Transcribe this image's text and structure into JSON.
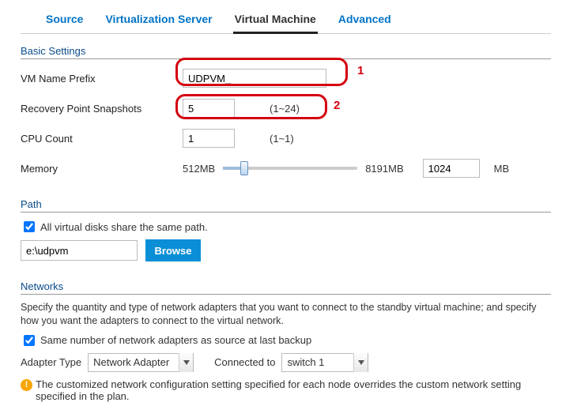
{
  "tabs": {
    "source": "Source",
    "virtualization_server": "Virtualization Server",
    "virtual_machine": "Virtual Machine",
    "advanced": "Advanced"
  },
  "basic": {
    "title": "Basic Settings",
    "vm_name_prefix_label": "VM Name Prefix",
    "vm_name_prefix_value": "UDPVM_",
    "annot1": "1",
    "recovery_label": "Recovery Point Snapshots",
    "recovery_value": "5",
    "recovery_hint": "(1~24)",
    "annot2": "2",
    "cpu_label": "CPU Count",
    "cpu_value": "1",
    "cpu_hint": "(1~1)",
    "memory_label": "Memory",
    "memory_min": "512MB",
    "memory_max": "8191MB",
    "memory_value": "1024",
    "memory_unit": "MB"
  },
  "path": {
    "title": "Path",
    "share_label": "All virtual disks share the same path.",
    "value": "e:\\udpvm",
    "browse": "Browse"
  },
  "networks": {
    "title": "Networks",
    "desc": "Specify the quantity and type of network adapters that you want to connect to the standby virtual machine; and specify how you want the adapters to connect to the virtual network.",
    "same_label": "Same number of network adapters as source at last backup",
    "adapter_type_label": "Adapter Type",
    "adapter_type_value": "Network Adapter",
    "connected_to_label": "Connected to",
    "connected_to_value": "switch 1",
    "warn": "The customized network configuration setting specified for each node overrides the custom network setting specified in the plan."
  }
}
